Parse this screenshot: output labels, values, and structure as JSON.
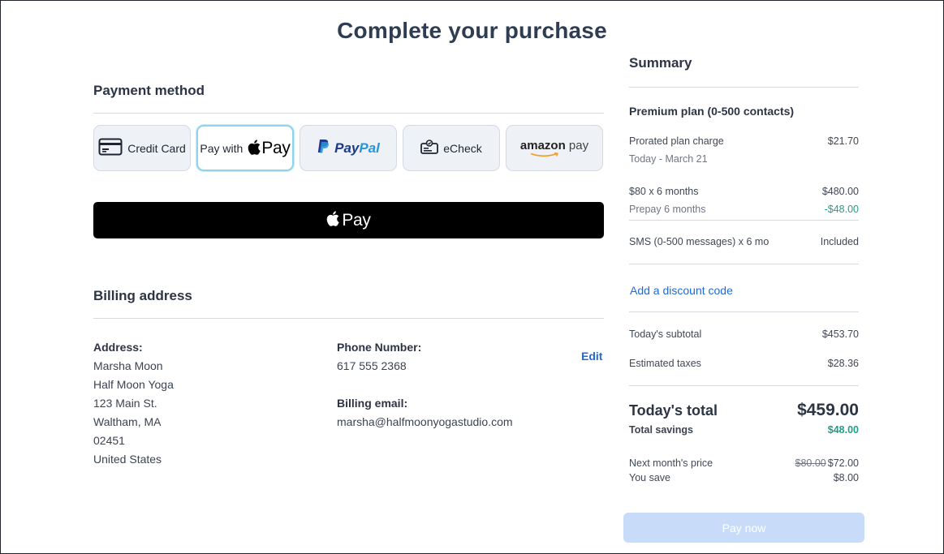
{
  "page_title": "Complete your purchase",
  "payment": {
    "heading": "Payment method",
    "methods": {
      "credit_card": "Credit Card",
      "apple_pay_prefix": "Pay with",
      "apple_pay_word": "Pay",
      "paypal_a": "Pay",
      "paypal_b": "Pal",
      "echeck": "eCheck",
      "amazon_a": "amazon",
      "amazon_b": "pay"
    },
    "selected": "apple_pay",
    "apple_pay_button": "Pay"
  },
  "billing": {
    "heading": "Billing address",
    "address_label": "Address:",
    "address_lines": [
      "Marsha Moon",
      "Half Moon Yoga",
      "123 Main St.",
      "Waltham, MA",
      "02451",
      "United States"
    ],
    "phone_label": "Phone Number:",
    "phone": "617 555 2368",
    "email_label": "Billing email:",
    "email": "marsha@halfmoonyogastudio.com",
    "edit": "Edit"
  },
  "summary": {
    "title": "Summary",
    "plan": "Premium plan (0-500 contacts)",
    "prorated_label": "Prorated plan charge",
    "prorated_value": "$21.70",
    "prorated_period": "Today - March 21",
    "monthly_label": "$80 x 6 months",
    "monthly_value": "$480.00",
    "prepay_label": "Prepay 6 months",
    "prepay_value": "-$48.00",
    "sms_label": "SMS (0-500 messages) x 6 mo",
    "sms_value": "Included",
    "discount_link": "Add a discount code",
    "subtotal_label": "Today's subtotal",
    "subtotal_value": "$453.70",
    "taxes_label": "Estimated taxes",
    "taxes_value": "$28.36",
    "total_label": "Today's total",
    "total_value": "$459.00",
    "savings_label": "Total savings",
    "savings_value": "$48.00",
    "next_label": "Next month's price",
    "next_old": "$80.00",
    "next_new": "$72.00",
    "save_label": "You save",
    "save_value": "$8.00",
    "pay_now": "Pay now"
  },
  "colors": {
    "accent_link": "#1f6bd6",
    "savings_green": "#1f9e88",
    "pay_now_disabled": "#c8dcf9",
    "selected_border": "#8fd3ec"
  }
}
